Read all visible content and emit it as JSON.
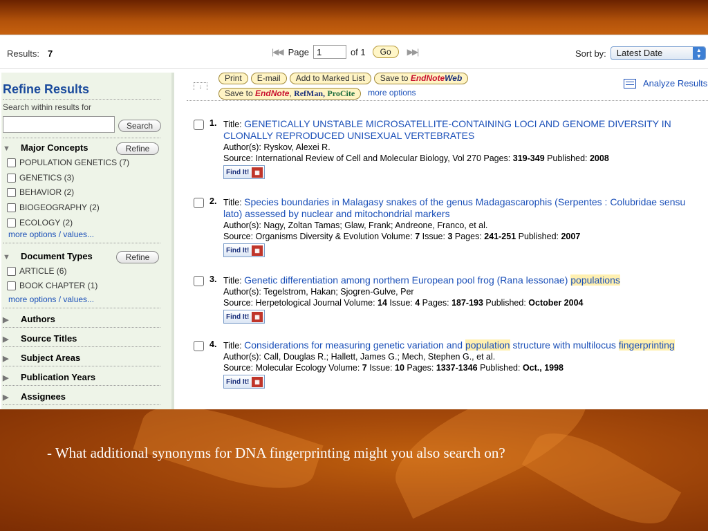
{
  "toolbar": {
    "results_label": "Results:",
    "results_count": "7",
    "page_label": "Page",
    "page_value": "1",
    "of_label": "of 1",
    "go_label": "Go",
    "sort_label": "Sort by:",
    "sort_value": "Latest Date"
  },
  "sidebar": {
    "title": "Refine Results",
    "search_within": "Search within results for",
    "search_button": "Search",
    "refine_button": "Refine",
    "major_concepts": {
      "heading": "Major Concepts",
      "options": [
        "POPULATION GENETICS (7)",
        "GENETICS (3)",
        "BEHAVIOR (2)",
        "BIOGEOGRAPHY (2)",
        "ECOLOGY (2)"
      ],
      "more": "more options / values..."
    },
    "document_types": {
      "heading": "Document Types",
      "options": [
        "ARTICLE (6)",
        "BOOK CHAPTER (1)"
      ],
      "more": "more options / values..."
    },
    "collapsed": [
      "Authors",
      "Source Titles",
      "Subject Areas",
      "Publication Years",
      "Assignees"
    ]
  },
  "actions": {
    "print": "Print",
    "email": "E-mail",
    "add_marked": "Add to Marked List",
    "save_to": "Save to",
    "endnote": "EndNote",
    "web": "Web",
    "refman": "RefMan,",
    "procite": "ProCite",
    "more_options": "more options",
    "analyze": "Analyze Results"
  },
  "records": [
    {
      "num": "1.",
      "title_label": "Title:",
      "title": "GENETICALLY UNSTABLE MICROSATELLITE-CONTAINING LOCI AND GENOME DIVERSITY IN CLONALLY REPRODUCED UNISEXUAL VERTEBRATES",
      "authors": "Author(s): Ryskov, Alexei R.",
      "source": "Source: International Review of Cell and Molecular Biology, Vol 270 Pages: ",
      "pages": "319-349",
      "published_label": " Published: ",
      "published": "2008",
      "findit": "Find It!"
    },
    {
      "num": "2.",
      "title_label": "Title:",
      "title": "Species boundaries in Malagasy snakes of the genus Madagascarophis (Serpentes : Colubridae sensu lato) assessed by nuclear and mitochondrial markers",
      "authors": "Author(s): Nagy, Zoltan Tamas; Glaw, Frank; Andreone, Franco, et al.",
      "source": "Source: Organisms Diversity & Evolution Volume: ",
      "volume": "7",
      "issue_label": " Issue: ",
      "issue": "3",
      "pages_label": " Pages: ",
      "pages": "241-251",
      "published_label": " Published: ",
      "published": "2007",
      "findit": "Find It!"
    },
    {
      "num": "3.",
      "title_label": "Title:",
      "title": "Genetic differentiation among northern European pool frog (Rana lessonae) ",
      "title_hl": "populations",
      "authors": "Author(s): Tegelstrom, Hakan; Sjogren-Gulve, Per",
      "source": "Source: Herpetological Journal Volume: ",
      "volume": "14",
      "issue_label": " Issue: ",
      "issue": "4",
      "pages_label": " Pages: ",
      "pages": "187-193",
      "published_label": " Published: ",
      "published": "October 2004",
      "findit": "Find It!"
    },
    {
      "num": "4.",
      "title_label": "Title:",
      "title_a": "Considerations for measuring genetic variation and ",
      "title_hl": "population",
      "title_b": " structure with multilocus ",
      "title_hl2": "fingerprinting",
      "authors": "Author(s): Call, Douglas R.; Hallett, James G.; Mech, Stephen G., et al.",
      "source": "Source: Molecular Ecology Volume: ",
      "volume": "7",
      "issue_label": " Issue: ",
      "issue": "10",
      "pages_label": " Pages: ",
      "pages": "1337-1346",
      "published_label": " Published: ",
      "published": "Oct., 1998",
      "findit": "Find It!"
    }
  ],
  "caption": "- What additional synonyms for DNA fingerprinting might you also search on?"
}
